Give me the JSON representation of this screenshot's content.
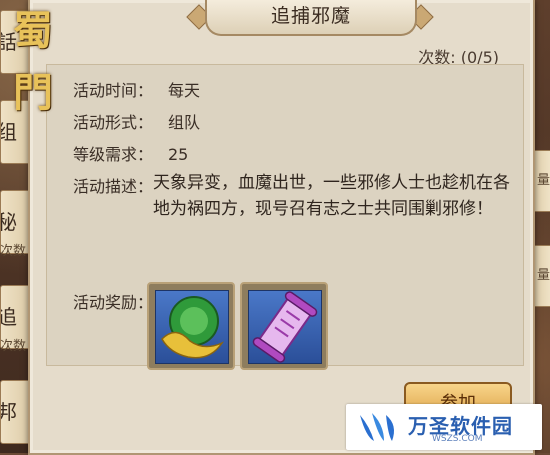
{
  "window": {
    "title": "追捕邪魔"
  },
  "count": "次数: (0/5)",
  "logo": {
    "text": "蜀門"
  },
  "side": {
    "tabs": [
      {
        "label": "話"
      },
      {
        "label": "组"
      },
      {
        "label": "秘"
      },
      {
        "label": "追"
      },
      {
        "label": "邦"
      }
    ],
    "subs": [
      "次数",
      "次数"
    ],
    "right_tabs": [
      "量",
      "量"
    ]
  },
  "info": {
    "time_label": "活动时间：",
    "time_value": "每天",
    "form_label": "活动形式：",
    "form_value": "组队",
    "level_label": "等级需求：",
    "level_value": "25",
    "desc_label": "活动描述：",
    "desc_value": "天象异变，血魔出世，一些邪修人士也趁机在各地为祸四方，现号召有志之士共同围剿邪修！",
    "reward_label": "活动奖励："
  },
  "rewards": [
    {
      "icon": "jade-orb-gold-ingot-icon"
    },
    {
      "icon": "purple-scroll-icon"
    }
  ],
  "join_button": "参加",
  "watermark": {
    "text": "万圣软件园",
    "sub": "WSZS.COM"
  }
}
